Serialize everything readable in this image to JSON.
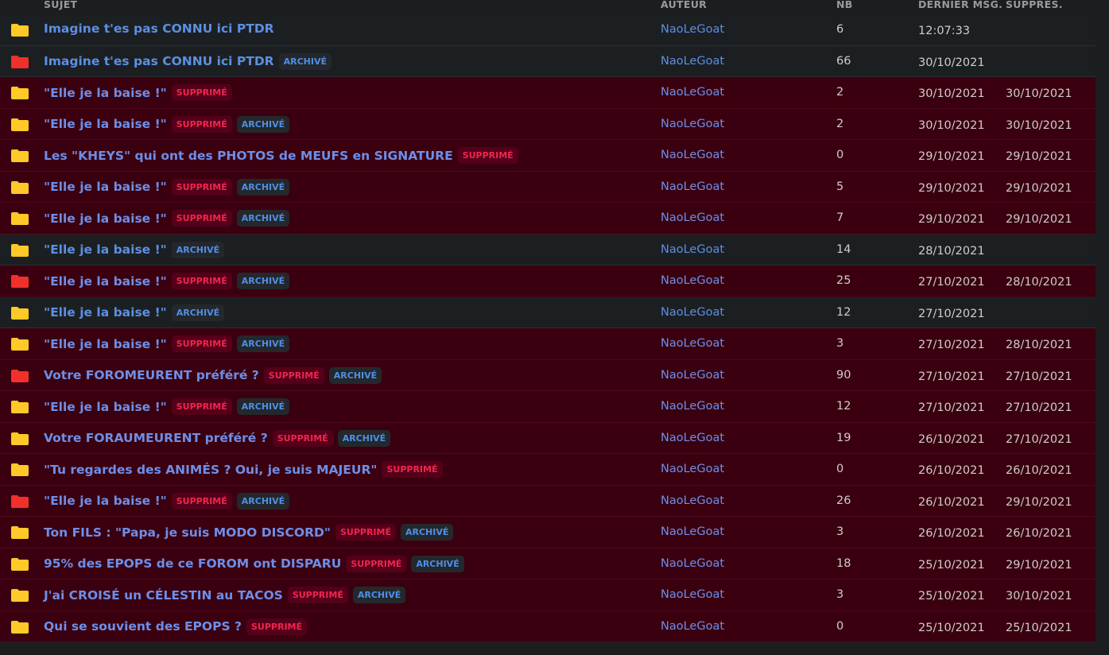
{
  "headers": {
    "subject": "SUJET",
    "author": "AUTEUR",
    "nb": "NB",
    "last": "DERNIER MSG.",
    "deleted": "SUPPRES."
  },
  "badges": {
    "deleted": "SUPPRIMÉ",
    "archived": "ARCHIVÉ"
  },
  "colors": {
    "folder_normal": "#ffc928",
    "folder_hot": "#f0302a",
    "deleted_row": "#3a0010"
  },
  "rows": [
    {
      "folder": "normal",
      "title": "Imagine t'es pas CONNU ici PTDR",
      "sup": false,
      "arc": false,
      "author": "NaoLeGoat",
      "nb": "6",
      "last": "12:07:33",
      "deleted_on": ""
    },
    {
      "folder": "hot",
      "title": "Imagine t'es pas CONNU ici PTDR",
      "sup": false,
      "arc": true,
      "author": "NaoLeGoat",
      "nb": "66",
      "last": "30/10/2021",
      "deleted_on": ""
    },
    {
      "folder": "normal",
      "title": "\"Elle je la baise !\"",
      "sup": true,
      "arc": false,
      "author": "NaoLeGoat",
      "nb": "2",
      "last": "30/10/2021",
      "deleted_on": "30/10/2021"
    },
    {
      "folder": "normal",
      "title": "\"Elle je la baise !\"",
      "sup": true,
      "arc": true,
      "author": "NaoLeGoat",
      "nb": "2",
      "last": "30/10/2021",
      "deleted_on": "30/10/2021"
    },
    {
      "folder": "normal",
      "title": "Les \"KHEYS\" qui ont des PHOTOS de MEUFS en SIGNATURE",
      "sup": true,
      "arc": false,
      "author": "NaoLeGoat",
      "nb": "0",
      "last": "29/10/2021",
      "deleted_on": "29/10/2021"
    },
    {
      "folder": "normal",
      "title": "\"Elle je la baise !\"",
      "sup": true,
      "arc": true,
      "author": "NaoLeGoat",
      "nb": "5",
      "last": "29/10/2021",
      "deleted_on": "29/10/2021"
    },
    {
      "folder": "normal",
      "title": "\"Elle je la baise !\"",
      "sup": true,
      "arc": true,
      "author": "NaoLeGoat",
      "nb": "7",
      "last": "29/10/2021",
      "deleted_on": "29/10/2021"
    },
    {
      "folder": "normal",
      "title": "\"Elle je la baise !\"",
      "sup": false,
      "arc": true,
      "author": "NaoLeGoat",
      "nb": "14",
      "last": "28/10/2021",
      "deleted_on": ""
    },
    {
      "folder": "hot",
      "title": "\"Elle je la baise !\"",
      "sup": true,
      "arc": true,
      "author": "NaoLeGoat",
      "nb": "25",
      "last": "27/10/2021",
      "deleted_on": "28/10/2021"
    },
    {
      "folder": "normal",
      "title": "\"Elle je la baise !\"",
      "sup": false,
      "arc": true,
      "author": "NaoLeGoat",
      "nb": "12",
      "last": "27/10/2021",
      "deleted_on": ""
    },
    {
      "folder": "normal",
      "title": "\"Elle je la baise !\"",
      "sup": true,
      "arc": true,
      "author": "NaoLeGoat",
      "nb": "3",
      "last": "27/10/2021",
      "deleted_on": "28/10/2021"
    },
    {
      "folder": "hot",
      "title": "Votre FOROMEURENT préféré ?",
      "sup": true,
      "arc": true,
      "author": "NaoLeGoat",
      "nb": "90",
      "last": "27/10/2021",
      "deleted_on": "27/10/2021"
    },
    {
      "folder": "normal",
      "title": "\"Elle je la baise !\"",
      "sup": true,
      "arc": true,
      "author": "NaoLeGoat",
      "nb": "12",
      "last": "27/10/2021",
      "deleted_on": "27/10/2021"
    },
    {
      "folder": "normal",
      "title": "Votre FORAUMEURENT préféré ?",
      "sup": true,
      "arc": true,
      "author": "NaoLeGoat",
      "nb": "19",
      "last": "26/10/2021",
      "deleted_on": "27/10/2021"
    },
    {
      "folder": "normal",
      "title": "\"Tu regardes des ANIMÉS ? Oui, je suis MAJEUR\"",
      "sup": true,
      "arc": false,
      "author": "NaoLeGoat",
      "nb": "0",
      "last": "26/10/2021",
      "deleted_on": "26/10/2021"
    },
    {
      "folder": "hot",
      "title": "\"Elle je la baise !\"",
      "sup": true,
      "arc": true,
      "author": "NaoLeGoat",
      "nb": "26",
      "last": "26/10/2021",
      "deleted_on": "29/10/2021"
    },
    {
      "folder": "normal",
      "title": "Ton FILS : \"Papa, je suis MODO DISCORD\"",
      "sup": true,
      "arc": true,
      "author": "NaoLeGoat",
      "nb": "3",
      "last": "26/10/2021",
      "deleted_on": "26/10/2021"
    },
    {
      "folder": "normal",
      "title": "95% des EPOPS de ce FOROM ont DISPARU",
      "sup": true,
      "arc": true,
      "author": "NaoLeGoat",
      "nb": "18",
      "last": "25/10/2021",
      "deleted_on": "29/10/2021"
    },
    {
      "folder": "normal",
      "title": "J'ai CROISÉ un CÉLESTIN au TACOS",
      "sup": true,
      "arc": true,
      "author": "NaoLeGoat",
      "nb": "3",
      "last": "25/10/2021",
      "deleted_on": "30/10/2021"
    },
    {
      "folder": "normal",
      "title": "Qui se souvient des EPOPS ?",
      "sup": true,
      "arc": false,
      "author": "NaoLeGoat",
      "nb": "0",
      "last": "25/10/2021",
      "deleted_on": "25/10/2021"
    }
  ]
}
